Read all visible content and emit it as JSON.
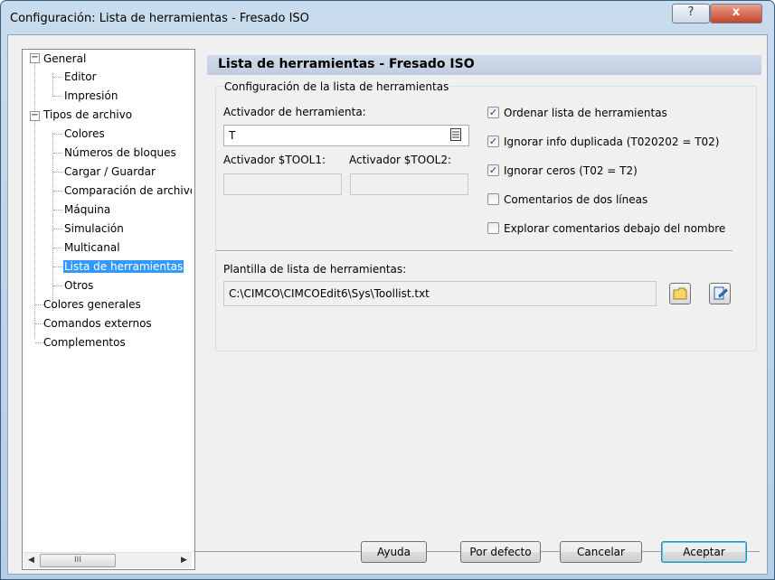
{
  "window": {
    "title": "Configuración: Lista de herramientas - Fresado ISO",
    "help_glyph": "?",
    "close_glyph": "x"
  },
  "tree": {
    "items": [
      {
        "label": "General"
      },
      {
        "label": "Editor"
      },
      {
        "label": "Impresión"
      },
      {
        "label": "Tipos de archivo"
      },
      {
        "label": "Colores"
      },
      {
        "label": "Números de bloques"
      },
      {
        "label": "Cargar / Guardar"
      },
      {
        "label": "Comparación de archivos"
      },
      {
        "label": "Máquina"
      },
      {
        "label": "Simulación"
      },
      {
        "label": "Multicanal"
      },
      {
        "label": "Lista de herramientas",
        "selected": true
      },
      {
        "label": "Otros"
      },
      {
        "label": "Colores generales"
      },
      {
        "label": "Comandos externos"
      },
      {
        "label": "Complementos"
      }
    ],
    "scroll_left": "◀",
    "scroll_right": "▶",
    "scroll_grip": "III"
  },
  "panel": {
    "header": "Lista de herramientas - Fresado ISO",
    "group_title": "Configuración de la lista de herramientas",
    "tool_activator_label": "Activador de herramienta:",
    "tool_activator_value": "T",
    "tool1_label": "Activador $TOOL1:",
    "tool1_value": "",
    "tool2_label": "Activador $TOOL2:",
    "tool2_value": "",
    "checkboxes": [
      {
        "label": "Ordenar lista de herramientas",
        "checked": true
      },
      {
        "label": "Ignorar info duplicada (T020202 = T02)",
        "checked": true
      },
      {
        "label": "Ignorar ceros (T02 = T2)",
        "checked": true
      },
      {
        "label": "Comentarios de dos líneas",
        "checked": false
      },
      {
        "label": "Explorar comentarios debajo del nombre",
        "checked": false
      }
    ],
    "template_label": "Plantilla de lista de herramientas:",
    "template_value": "C:\\CIMCO\\CIMCOEdit6\\Sys\\Toollist.txt"
  },
  "buttons": {
    "help": "Ayuda",
    "default": "Por defecto",
    "cancel": "Cancelar",
    "accept": "Aceptar"
  },
  "colors": {
    "selection": "#3399ff",
    "header_bg": "#c5d3e4",
    "check_mark": "#21349a"
  }
}
